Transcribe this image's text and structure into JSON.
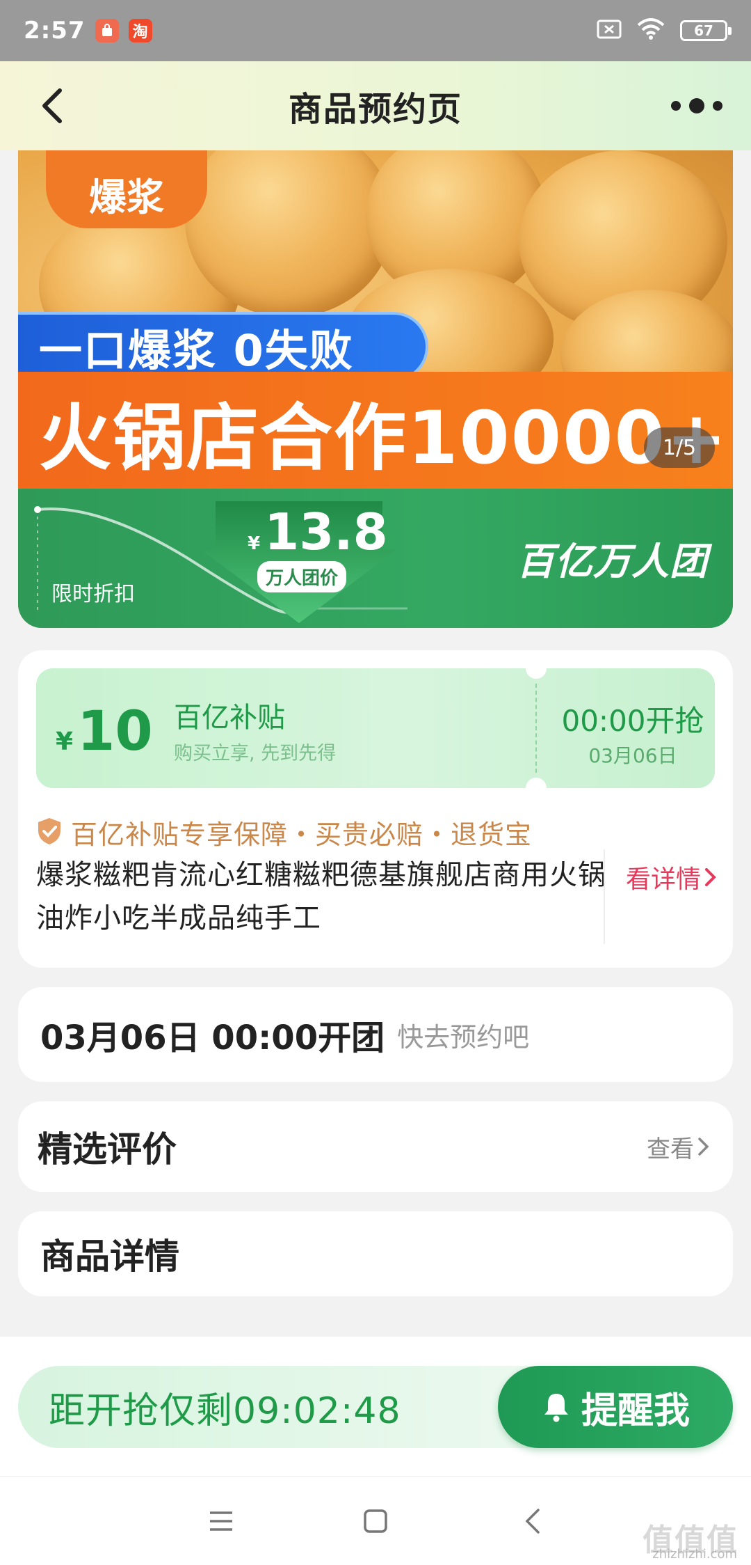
{
  "status_bar": {
    "time": "2:57",
    "app1_icon": "shopping-bag-icon",
    "app2_label": "淘",
    "battery": "67"
  },
  "header": {
    "title": "商品预约页"
  },
  "banner": {
    "badge": "爆浆",
    "slogan": "一口爆浆 0失败",
    "big_slogan": "火锅店合作10000+",
    "page_indicator": "1/5",
    "limited_label": "限时折扣",
    "price_currency": "¥",
    "price": "13.8",
    "price_tag": "万人团价",
    "brand": "百亿万人团",
    "colors": {
      "orange": "#f2691c",
      "blue": "#1e5fd8",
      "green": "#2f9a58"
    }
  },
  "subsidy": {
    "currency": "¥",
    "amount": "10",
    "title": "百亿补贴",
    "subtitle": "购买立享, 先到先得",
    "start_time": "00:00开抢",
    "start_date": "03月06日"
  },
  "guarantee": {
    "text": "百亿补贴专享保障・买贵必赔・退货宝"
  },
  "product": {
    "title": "爆浆糍粑肯流心红糖糍粑德基旗舰店商用火锅油炸小吃半成品纯手工",
    "details_link": "看详情"
  },
  "open_info": {
    "time": "03月06日 00:00开团",
    "hint": "快去预约吧"
  },
  "reviews": {
    "title": "精选评价",
    "more": "查看"
  },
  "details": {
    "title": "商品详情"
  },
  "action_bar": {
    "countdown": "距开抢仅剩09:02:48",
    "remind_label": "提醒我"
  },
  "watermark": {
    "text": "值值值",
    "site": "zhizhizhi.com"
  },
  "accent_color": "#1f9a48"
}
